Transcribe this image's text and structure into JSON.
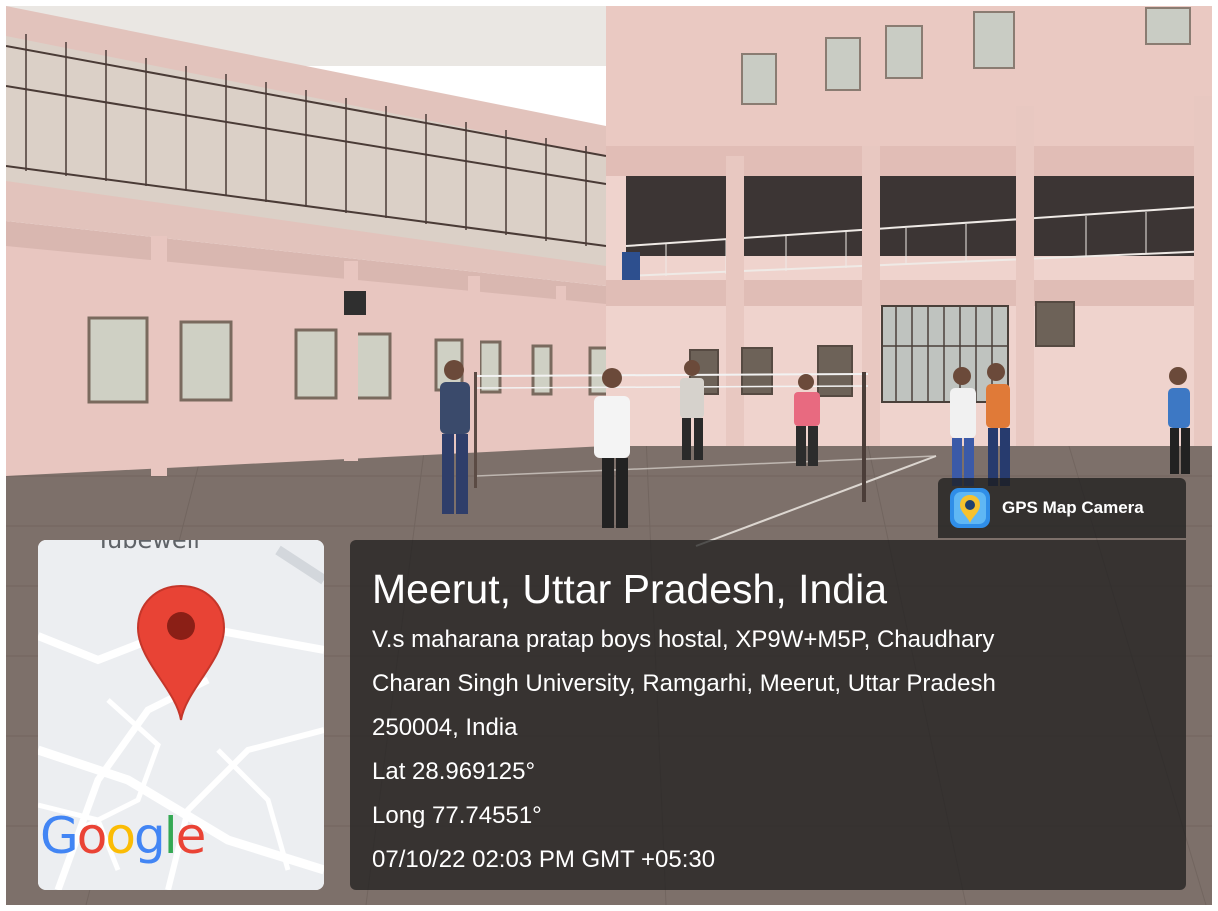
{
  "map": {
    "place_label": "Tubewell",
    "logo": {
      "G": "G",
      "o1": "o",
      "o2": "o",
      "g": "g",
      "l": "l",
      "e": "e"
    },
    "pin_icon": "map-pin-icon",
    "pin_color": "#ea4335"
  },
  "badge": {
    "icon": "map-camera-icon",
    "label": "GPS Map Camera"
  },
  "info": {
    "title": "Meerut, Uttar Pradesh, India",
    "address_line1": "V.s maharana pratap boys hostal, XP9W+M5P, Chaudhary",
    "address_line2": "Charan Singh University, Ramgarhi, Meerut, Uttar Pradesh",
    "address_line3": "250004, India",
    "lat": "Lat 28.969125°",
    "long": "Long 77.74551°",
    "datetime": "07/10/22 02:03 PM GMT +05:30"
  },
  "colors": {
    "wall": "#e9c9c3",
    "ground": "#7d6f68",
    "overlay": "#1c1c1c"
  }
}
